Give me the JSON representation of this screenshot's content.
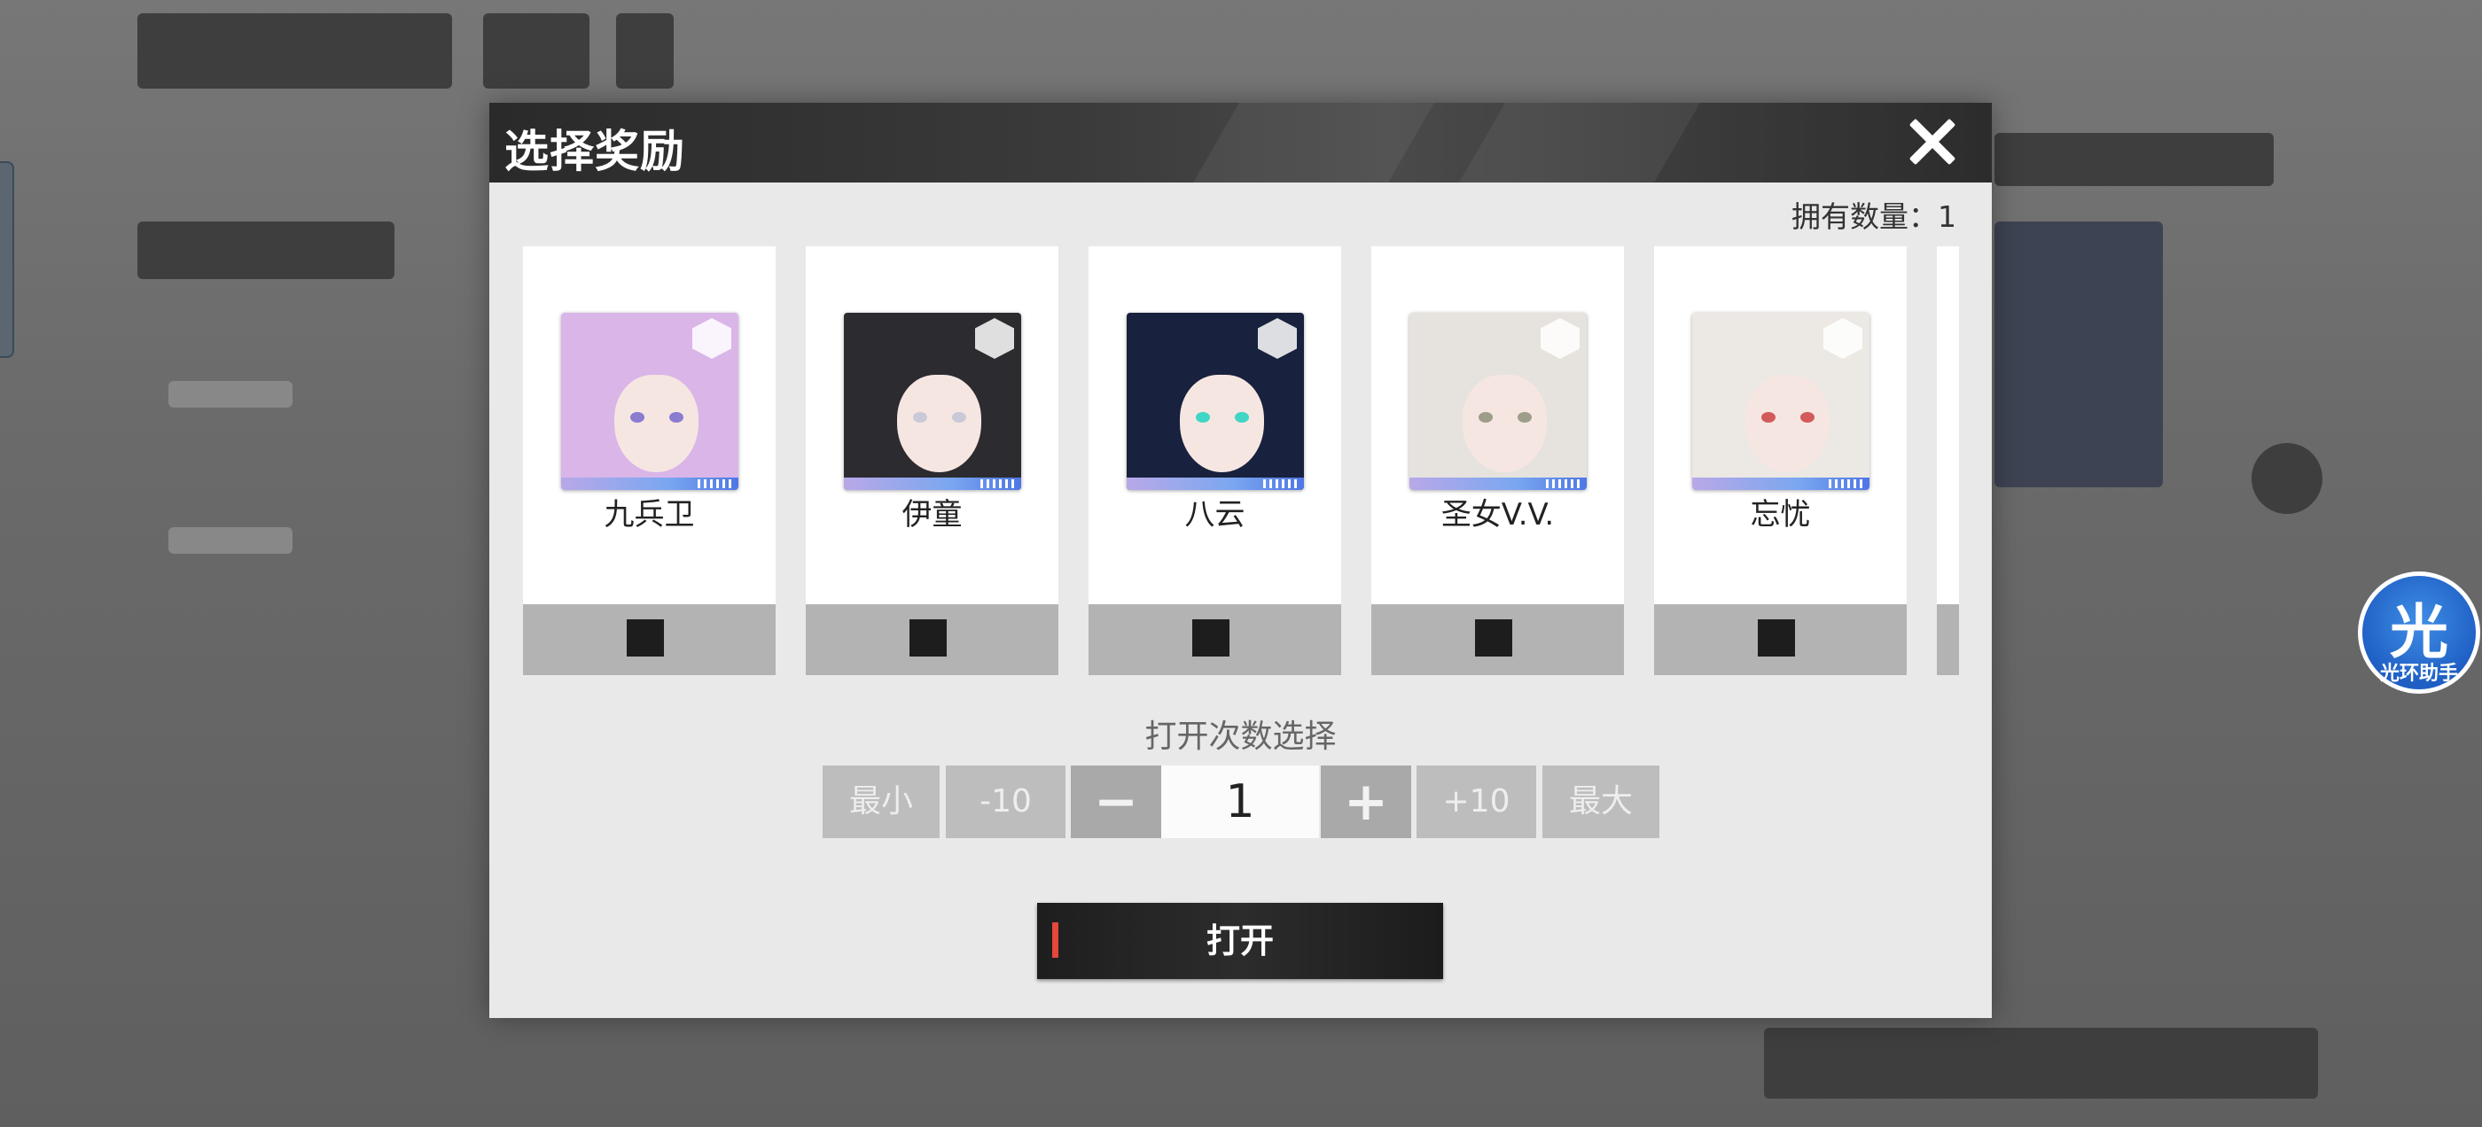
{
  "modal": {
    "title": "选择奖励",
    "owned_label": "拥有数量：1"
  },
  "rewards": [
    {
      "name": "九兵卫",
      "hair": "#d9b5e8",
      "eye": "#8a7cd0"
    },
    {
      "name": "伊童",
      "hair": "#2b2b30",
      "eye": "#c9c9d8"
    },
    {
      "name": "八云",
      "hair": "#18213d",
      "eye": "#3fd6c6"
    },
    {
      "name": "圣女V.V.",
      "hair": "#e6e3de",
      "eye": "#9d9d8a"
    },
    {
      "name": "忘忧",
      "hair": "#ece8e4",
      "eye": "#d35a5a"
    }
  ],
  "count_selector": {
    "label": "打开次数选择",
    "min_label": "最小",
    "minus10_label": "-10",
    "minus_label": "−",
    "quantity": "1",
    "plus_label": "+",
    "plus10_label": "+10",
    "max_label": "最大"
  },
  "open_button": {
    "label": "打开"
  },
  "assistant": {
    "icon_char": "光",
    "label": "光环助手"
  },
  "colors": {
    "accent_red": "#e4473b",
    "assistant_blue": "#2a6fd6"
  }
}
